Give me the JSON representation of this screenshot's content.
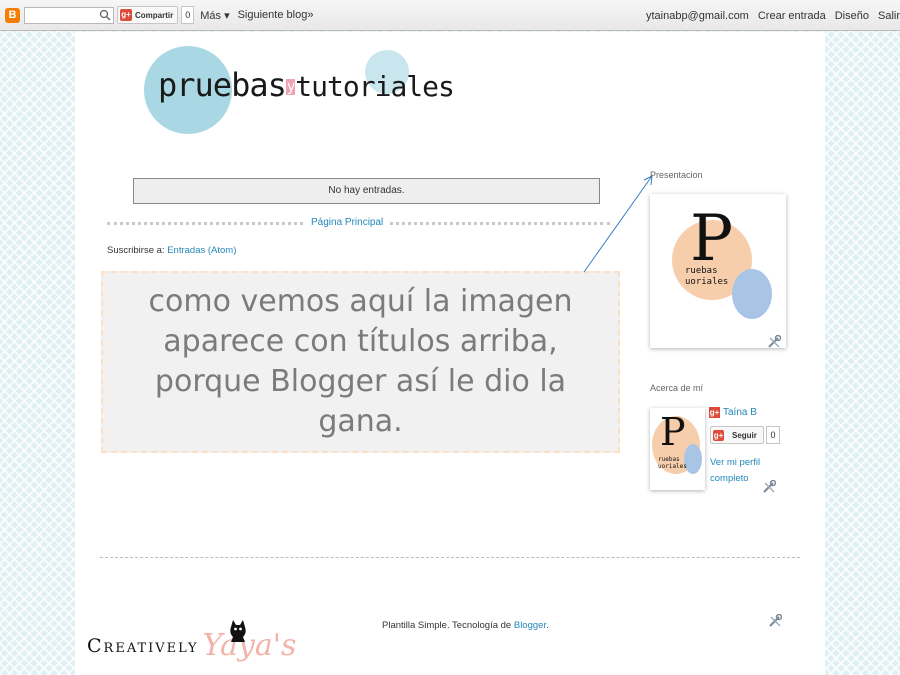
{
  "navbar": {
    "blogger_icon": "blogger-b-icon",
    "search_placeholder": "",
    "share_label": "Compartir",
    "share_count": "0",
    "more_label": "Más ▾",
    "next_blog_label": "Siguiente blog»",
    "email": "ytainabp@gmail.com",
    "create_post": "Crear entrada",
    "design": "Diseño",
    "sign_out": "Salir"
  },
  "header": {
    "logo_main": "pruebas",
    "logo_y": "y",
    "logo_tut": "tutoriales"
  },
  "main": {
    "no_posts": "No hay entradas.",
    "home_link": "Página Principal",
    "subscribe_label": "Suscribirse a:",
    "subscribe_link": "Entradas (Atom)"
  },
  "annotation": {
    "text": "como vemos aquí la imagen aparece con títulos arriba, porque Blogger así le dio la gana."
  },
  "sidebar": {
    "presentation_title": "Presentacion",
    "about_title": "Acerca de mí",
    "avatar_letter": "P",
    "avatar_mini_1": "ruebas",
    "avatar_mini_2": "uoriales",
    "profile_name": "Taína B",
    "follow_label": "Seguir",
    "follow_count": "0",
    "profile_link": "Ver mi perfil completo"
  },
  "footer": {
    "text_prefix": "Plantilla Simple. Tecnología de ",
    "blogger_link": "Blogger",
    "text_suffix": "."
  },
  "watermark": {
    "text_a": "Creatively",
    "text_b": "Yaya's"
  },
  "colors": {
    "background": "#dff0f3",
    "link": "#2288bb",
    "logo_circle": "#a9d8e4",
    "peach": "#f7ceac",
    "blue_accent": "#a9c5e5",
    "callout_border": "#fbe0c5"
  }
}
